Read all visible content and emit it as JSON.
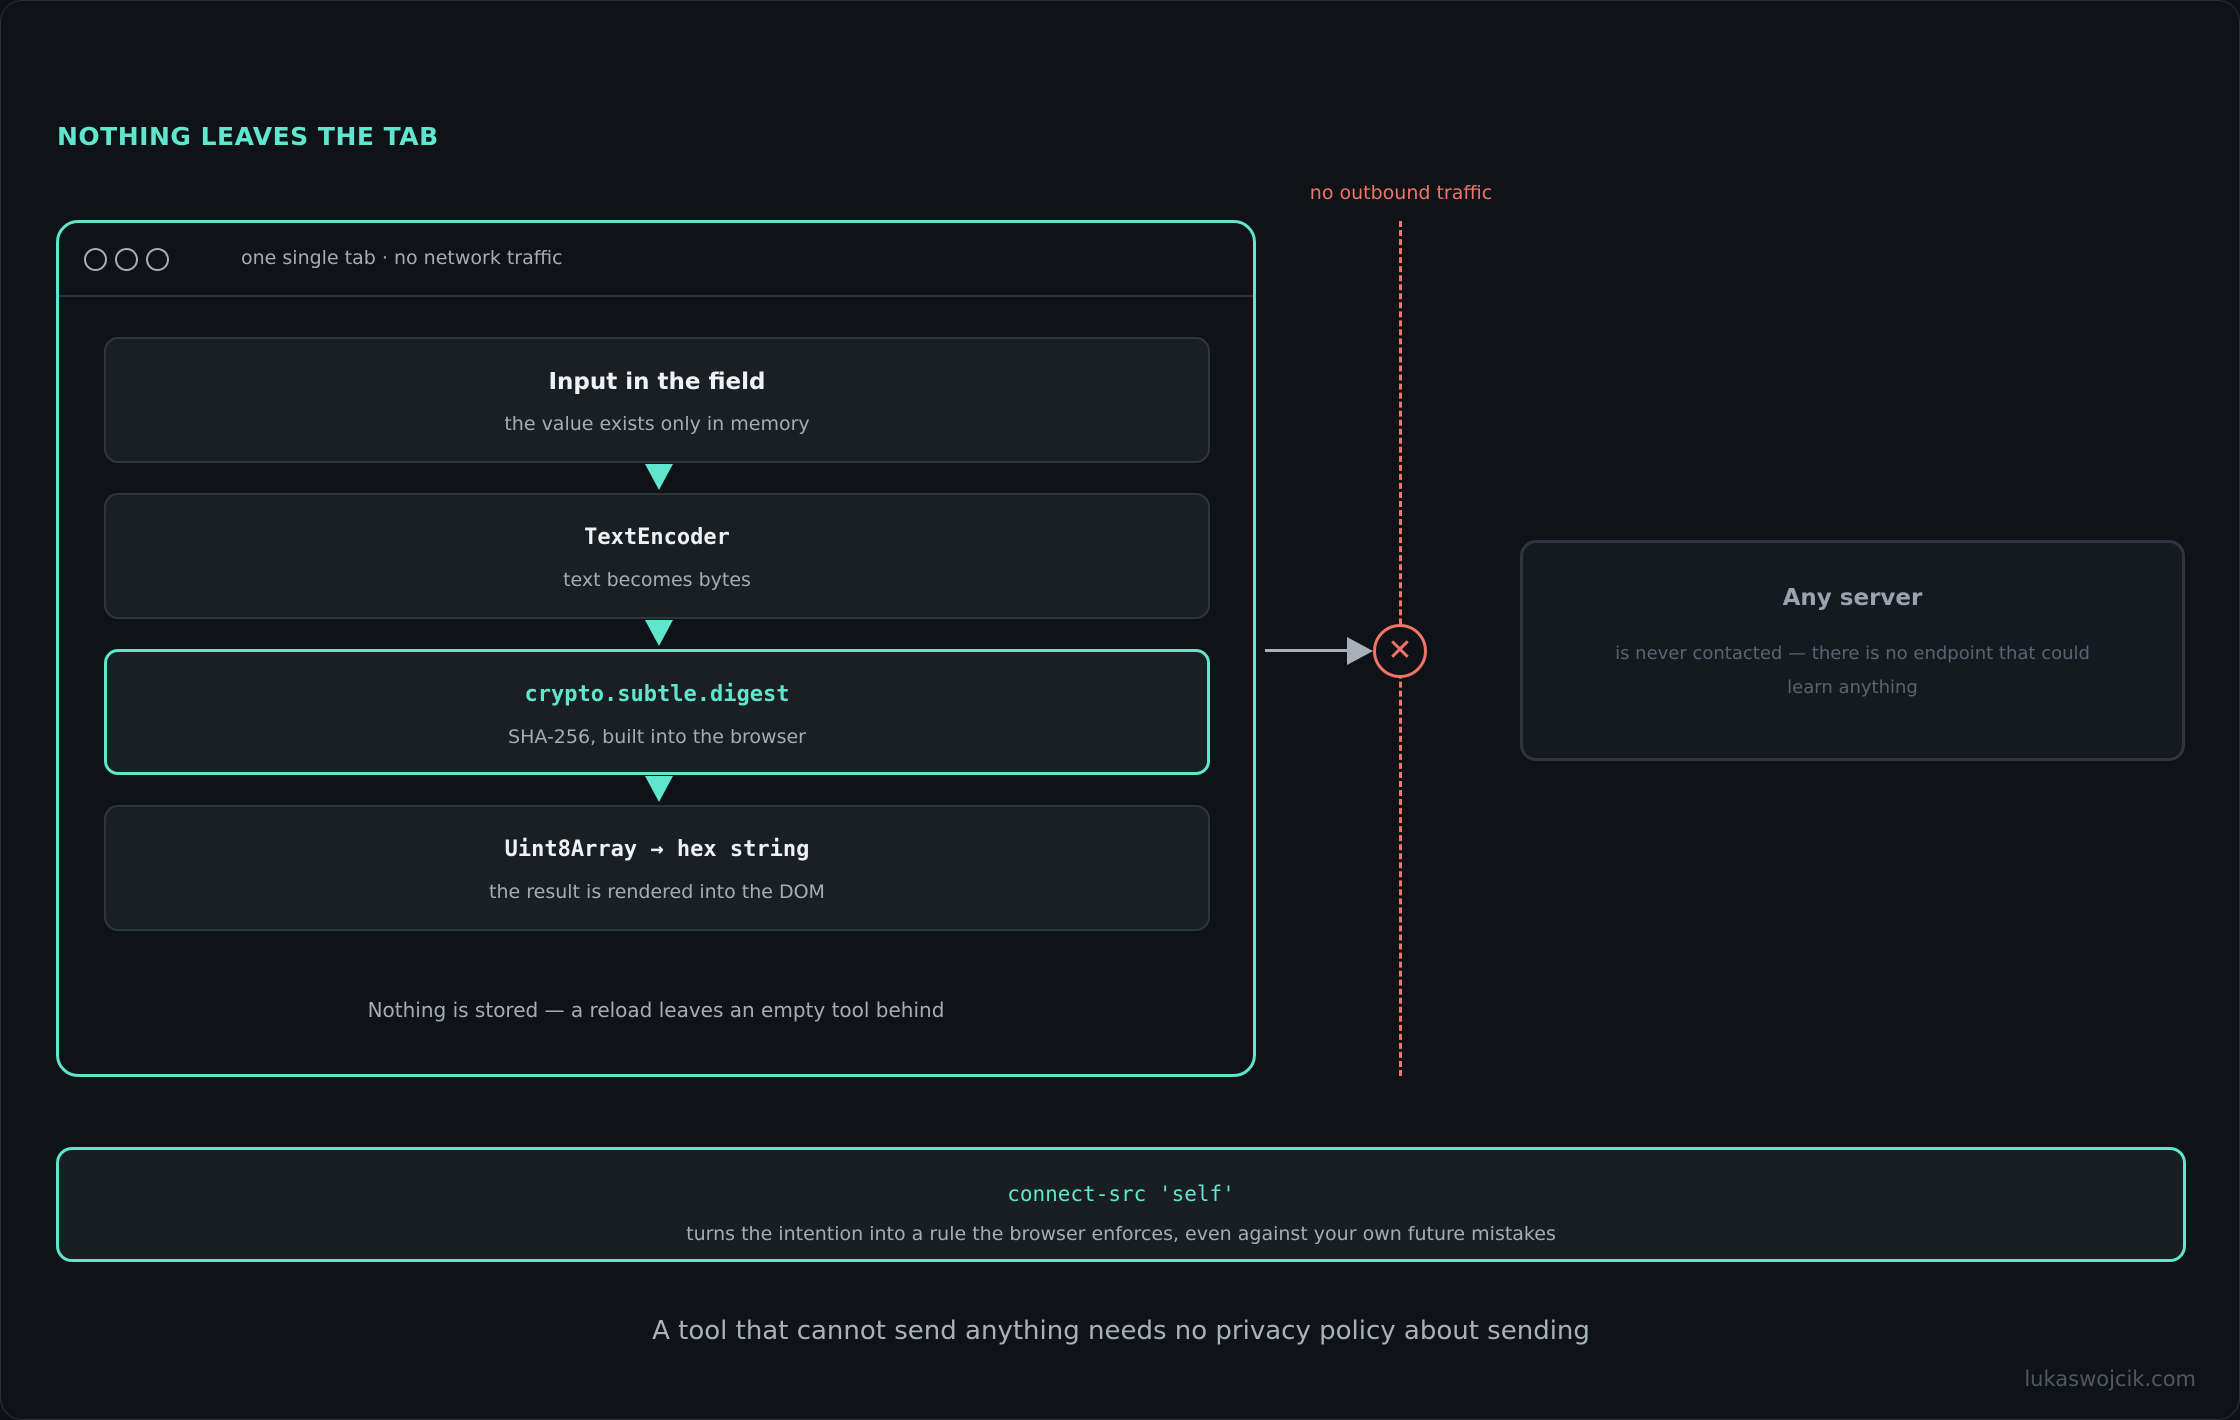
{
  "heading": "NOTHING LEAVES THE TAB",
  "browser": {
    "tab_label": "one single tab · no network traffic",
    "steps": [
      {
        "title": "Input in the field",
        "subtitle": "the value exists only in memory"
      },
      {
        "title": "TextEncoder",
        "subtitle": "text becomes bytes"
      },
      {
        "title": "crypto.subtle.digest",
        "subtitle": "SHA-256, built into the browser"
      },
      {
        "title": "Uint8Array → hex string",
        "subtitle": "the result is rendered into the DOM"
      }
    ],
    "footnote": "Nothing is stored — a reload leaves an empty tool behind"
  },
  "boundary": {
    "label": "no outbound traffic",
    "blocked_symbol": "✕"
  },
  "server": {
    "title": "Any server",
    "description": "is never contacted — there is no endpoint that could learn anything"
  },
  "csp": {
    "directive": "connect-src 'self'",
    "description": "turns the intention into a rule the browser enforces, even against your own future mistakes"
  },
  "tagline": "A tool that cannot send anything needs no privacy policy about sending",
  "brand": "lukaswojcik.com",
  "colors": {
    "accent": "#5fe6cd",
    "danger": "#f07468",
    "background": "#0f1317"
  }
}
